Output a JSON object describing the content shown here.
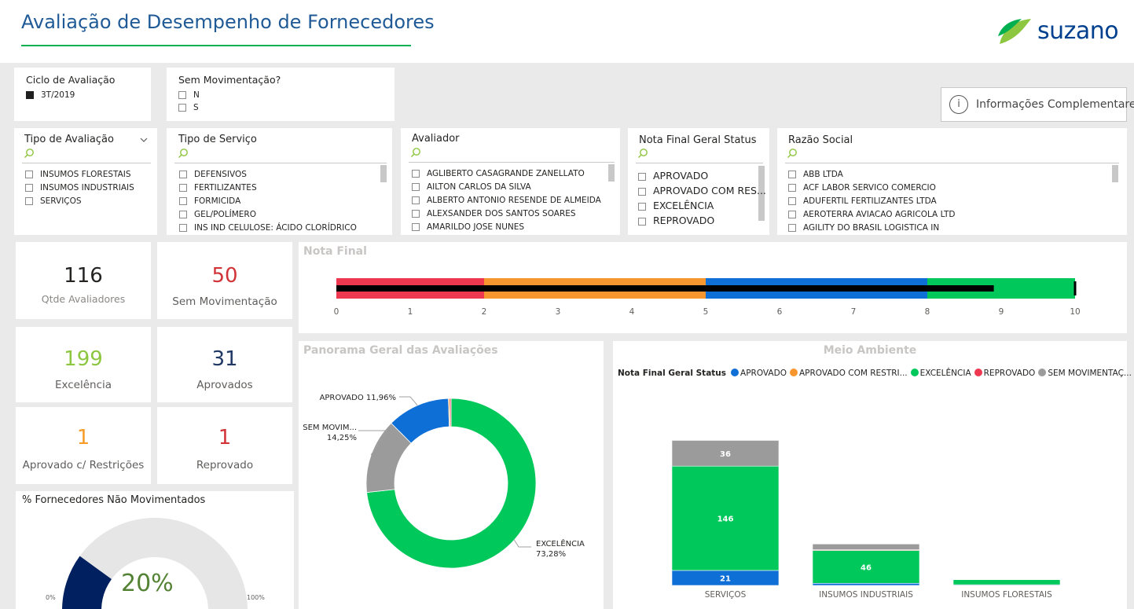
{
  "header": {
    "title": "Avaliação de Desempenho de Fornecedores",
    "brand": "suzano",
    "brand_color": "#00408f",
    "accent_color": "#00b050"
  },
  "info_button": {
    "label": "Informações Complementares",
    "icon": "info-icon"
  },
  "slicers": {
    "ciclo": {
      "title": "Ciclo de Avaliação",
      "items": [
        {
          "label": "3T/2019",
          "checked": true
        }
      ]
    },
    "sem_mov": {
      "title": "Sem Movimentação?",
      "items": [
        {
          "label": "N"
        },
        {
          "label": "S"
        }
      ]
    },
    "tipo_avaliacao": {
      "title": "Tipo de Avaliação",
      "items": [
        {
          "label": "INSUMOS FLORESTAIS"
        },
        {
          "label": "INSUMOS INDUSTRIAIS"
        },
        {
          "label": "SERVIÇOS"
        }
      ]
    },
    "tipo_servico": {
      "title": "Tipo de Serviço",
      "items": [
        {
          "label": "DEFENSIVOS"
        },
        {
          "label": "FERTILIZANTES"
        },
        {
          "label": "FORMICIDA"
        },
        {
          "label": "GEL/POLÍMERO"
        },
        {
          "label": "INS IND CELULOSE: ÁCIDO CLORÍDRICO"
        }
      ]
    },
    "avaliador": {
      "title": "Avaliador",
      "items": [
        {
          "label": "AGLIBERTO CASAGRANDE ZANELLATO"
        },
        {
          "label": "AILTON CARLOS DA SILVA"
        },
        {
          "label": "ALBERTO ANTONIO RESENDE DE ALMEIDA"
        },
        {
          "label": "ALEXSANDER DOS SANTOS SOARES"
        },
        {
          "label": "AMARILDO JOSE NUNES"
        }
      ]
    },
    "nota_status": {
      "title": "Nota Final Geral Status",
      "items": [
        {
          "label": "APROVADO"
        },
        {
          "label": "APROVADO COM RES..."
        },
        {
          "label": "EXCELÊNCIA"
        },
        {
          "label": "REPROVADO"
        }
      ]
    },
    "razao_social": {
      "title": "Razão Social",
      "items": [
        {
          "label": "ABB LTDA"
        },
        {
          "label": "ACF LABOR SERVICO COMERCIO"
        },
        {
          "label": "ADUFERTIL FERTILIZANTES LTDA"
        },
        {
          "label": "AEROTERRA AVIACAO AGRICOLA LTD"
        },
        {
          "label": "AGILITY DO BRASIL LOGISTICA IN"
        }
      ]
    }
  },
  "kpis": {
    "avaliadores": {
      "value": "116",
      "label": "Qtde Avaliadores",
      "color": "#252423"
    },
    "sem_mov": {
      "value": "50",
      "label": "Sem Movimentação",
      "color": "#d13438"
    },
    "excelencia": {
      "value": "199",
      "label": "Excelência",
      "color": "#8dc63f"
    },
    "aprovados": {
      "value": "31",
      "label": "Aprovados",
      "color": "#1f3864"
    },
    "aprovado_restr": {
      "value": "1",
      "label": "Aprovado c/ Restrições",
      "color": "#f59c2a"
    },
    "reprovado": {
      "value": "1",
      "label": "Reprovado",
      "color": "#d13438"
    }
  },
  "colors": {
    "aprovado": "#0e6fd6",
    "aprovado_restr": "#f7962f",
    "excelencia": "#00c85b",
    "reprovado": "#ee3850",
    "sem_mov": "#9b9b9b",
    "gauge_fill": "#002060",
    "gauge_track": "#e6e6e6"
  },
  "chart_data": [
    {
      "type": "bar",
      "title": "Nota Final",
      "orientation": "horizontal-bullet",
      "x_ticks": [
        "0",
        "1",
        "2",
        "3",
        "4",
        "5",
        "6",
        "7",
        "8",
        "9",
        "10"
      ],
      "xlim": [
        0,
        10
      ],
      "bands": [
        {
          "from": 0,
          "to": 2,
          "color": "#ee3850"
        },
        {
          "from": 2,
          "to": 5,
          "color": "#f7962f"
        },
        {
          "from": 5,
          "to": 8,
          "color": "#0e6fd6"
        },
        {
          "from": 8,
          "to": 10,
          "color": "#00c85b"
        }
      ],
      "value": 8.9,
      "target": 10
    },
    {
      "type": "pie",
      "title": "Panorama Geral das Avaliações",
      "donut": true,
      "slices": [
        {
          "label": "EXCELÊNCIA",
          "pct_label": "73,28%",
          "value": 73.28,
          "color": "#00c85b"
        },
        {
          "label": "SEM MOVIM...",
          "pct_label": "14,25%",
          "value": 14.25,
          "color": "#9b9b9b"
        },
        {
          "label": "APROVADO",
          "pct_label": "11,96%",
          "value": 11.96,
          "color": "#0e6fd6"
        },
        {
          "label": "",
          "pct_label": "",
          "value": 0.26,
          "color": "#f7962f"
        },
        {
          "label": "",
          "pct_label": "",
          "value": 0.25,
          "color": "#ee3850"
        }
      ]
    },
    {
      "type": "bar",
      "title": "Meio Ambiente",
      "stacked": true,
      "legend_title": "Nota Final Geral Status",
      "legend": [
        {
          "name": "APROVADO",
          "color": "#0e6fd6"
        },
        {
          "name": "APROVADO COM RESTRI...",
          "color": "#f7962f"
        },
        {
          "name": "EXCELÊNCIA",
          "color": "#00c85b"
        },
        {
          "name": "REPROVADO",
          "color": "#ee3850"
        },
        {
          "name": "SEM MOVIMENTAÇ...",
          "color": "#9b9b9b"
        }
      ],
      "categories": [
        "SERVIÇOS",
        "INSUMOS INDUSTRIAIS",
        "INSUMOS FLORESTAIS"
      ],
      "ylim": [
        0,
        220
      ],
      "series": [
        {
          "name": "APROVADO",
          "values": [
            21,
            3,
            1
          ],
          "color": "#0e6fd6",
          "labels": [
            "21",
            "",
            ""
          ]
        },
        {
          "name": "EXCELÊNCIA",
          "values": [
            146,
            46,
            7
          ],
          "color": "#00c85b",
          "labels": [
            "146",
            "46",
            ""
          ]
        },
        {
          "name": "REPROVADO",
          "values": [
            0,
            1,
            0
          ],
          "color": "#ee3850",
          "labels": [
            "",
            "",
            ""
          ]
        },
        {
          "name": "SEM MOVIMENTAÇ...",
          "values": [
            36,
            8,
            0
          ],
          "color": "#9b9b9b",
          "labels": [
            "36",
            "",
            ""
          ]
        }
      ]
    },
    {
      "type": "gauge",
      "title": "% Fornecedores Não Movimentados",
      "value": 20,
      "value_label": "20%",
      "min_label": "0%",
      "max_label": "100%",
      "min": 0,
      "max": 100
    }
  ]
}
